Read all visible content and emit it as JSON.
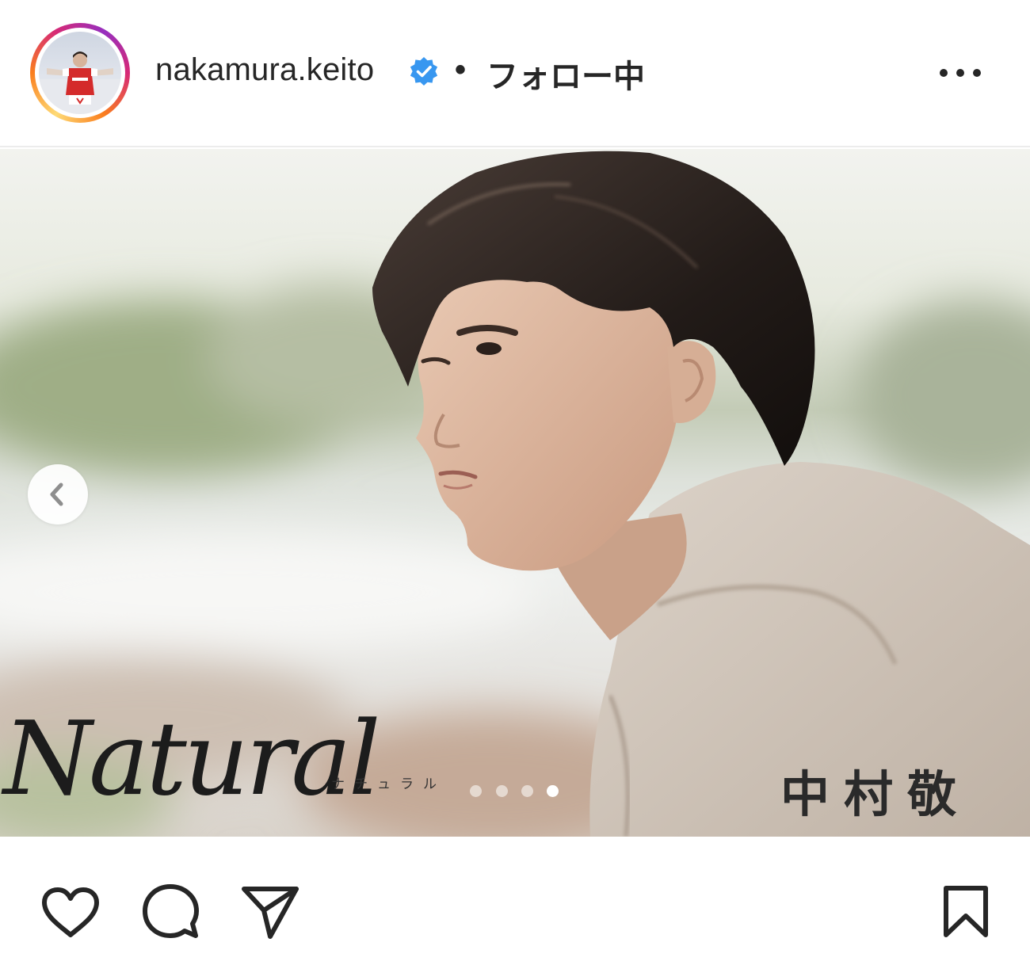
{
  "header": {
    "username": "nakamura.keito",
    "separator": "•",
    "follow_status": "フォロー中",
    "verified": true,
    "avatar_icon": "profile-photo-avatar",
    "more_icon": "more-options-icon"
  },
  "post": {
    "image_icon": "post-photo",
    "overlay_title": "Natural",
    "overlay_title_kana": "ナチュラル",
    "overlay_name": "中村敬斗",
    "carousel": {
      "total": 4,
      "active_index": 4
    },
    "prev_icon": "chevron-left-icon"
  },
  "actions": {
    "like_icon": "heart-icon",
    "comment_icon": "comment-icon",
    "share_icon": "paper-plane-icon",
    "save_icon": "bookmark-icon"
  },
  "colors": {
    "verified_blue": "#3897f0",
    "text": "#262626",
    "ring_gradient": [
      "#feda75",
      "#fa7e1e",
      "#d62976",
      "#962fbf"
    ]
  }
}
